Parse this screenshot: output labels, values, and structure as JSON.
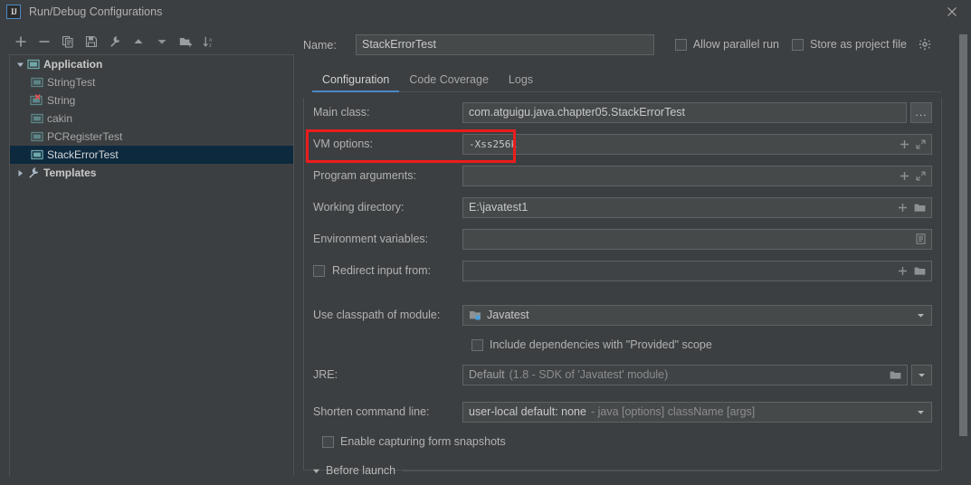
{
  "window": {
    "title": "Run/Debug Configurations",
    "logo_text": "IJ",
    "close_icon": "close-icon"
  },
  "toolbar": {
    "items": [
      {
        "name": "add-configuration-button",
        "icon": "plus-icon",
        "label": "+"
      },
      {
        "name": "remove-configuration-button",
        "icon": "minus-icon",
        "label": "−"
      },
      {
        "name": "copy-configuration-button",
        "icon": "copy-icon",
        "label": "Copy"
      },
      {
        "name": "save-configuration-button",
        "icon": "save-icon",
        "label": "Save"
      },
      {
        "name": "edit-templates-button",
        "icon": "wrench-icon",
        "label": "Edit Templates"
      },
      {
        "name": "move-up-button",
        "icon": "arrow-up-icon",
        "label": "Move Up"
      },
      {
        "name": "move-down-button",
        "icon": "arrow-down-icon",
        "label": "Move Down"
      },
      {
        "name": "new-folder-button",
        "icon": "folder-add-icon",
        "label": "New Folder"
      },
      {
        "name": "sort-configurations-button",
        "icon": "sort-az-icon",
        "label": "Sort"
      }
    ]
  },
  "tree": {
    "nodes": [
      {
        "label": "Application",
        "icon": "application-icon",
        "level": 1,
        "expanded": true,
        "selected": false,
        "bold": true,
        "error": false
      },
      {
        "label": "StringTest",
        "icon": "run-config-icon",
        "level": 2,
        "expanded": null,
        "selected": false,
        "bold": false,
        "error": false
      },
      {
        "label": "String",
        "icon": "run-config-icon",
        "level": 2,
        "expanded": null,
        "selected": false,
        "bold": false,
        "error": true
      },
      {
        "label": "cakin",
        "icon": "run-config-icon",
        "level": 2,
        "expanded": null,
        "selected": false,
        "bold": false,
        "error": false
      },
      {
        "label": "PCRegisterTest",
        "icon": "run-config-icon",
        "level": 2,
        "expanded": null,
        "selected": false,
        "bold": false,
        "error": false
      },
      {
        "label": "StackErrorTest",
        "icon": "run-config-icon",
        "level": 2,
        "expanded": null,
        "selected": true,
        "bold": false,
        "error": false
      },
      {
        "label": "Templates",
        "icon": "wrench-icon",
        "level": 1,
        "expanded": false,
        "selected": false,
        "bold": true,
        "error": false
      }
    ]
  },
  "header": {
    "name_label": "Name:",
    "name_value": "StackErrorTest",
    "allow_parallel_run_label": "Allow parallel run",
    "allow_parallel_run_checked": false,
    "store_as_project_file_label": "Store as project file",
    "store_as_project_file_checked": false,
    "gear_icon": "gear-icon"
  },
  "tabs": [
    {
      "label": "Configuration",
      "active": true
    },
    {
      "label": "Code Coverage",
      "active": false
    },
    {
      "label": "Logs",
      "active": false
    }
  ],
  "form": {
    "main_class": {
      "label": "Main class:",
      "value": "com.atguigu.java.chapter05.StackErrorTest",
      "browse_label": "..."
    },
    "vm_options": {
      "label": "VM options:",
      "value": "-Xss256k",
      "highlighted": true,
      "highlight_color": "#ec1c1c"
    },
    "program_arguments": {
      "label": "Program arguments:",
      "value": ""
    },
    "working_directory": {
      "label": "Working directory:",
      "value": "E:\\javatest1"
    },
    "environment_variables": {
      "label": "Environment variables:",
      "value": ""
    },
    "redirect_input": {
      "label": "Redirect input from:",
      "checked": false,
      "value": ""
    },
    "use_classpath_of_module": {
      "label": "Use classpath of module:",
      "value": "Javatest"
    },
    "include_provided_scope": {
      "label": "Include dependencies with \"Provided\" scope",
      "checked": false
    },
    "jre": {
      "label": "JRE:",
      "value": "Default",
      "value_sub": "(1.8 - SDK of 'Javatest' module)"
    },
    "shorten_command_line": {
      "label": "Shorten command line:",
      "value": "user-local default: none",
      "value_sub": "- java [options] className [args]"
    },
    "enable_capturing_form_snapshots": {
      "label": "Enable capturing form snapshots",
      "checked": false
    }
  },
  "before_launch": {
    "label": "Before launch",
    "expanded": true
  },
  "colors": {
    "background": "#3c3f41",
    "field_background": "#45494a",
    "border": "#4e5254",
    "accent_blue": "#4a88c7",
    "selection": "#0d293e",
    "text": "#b2b2b2",
    "annotation_red": "#ec1c1c",
    "icon_teal": "#5f9ea0"
  }
}
